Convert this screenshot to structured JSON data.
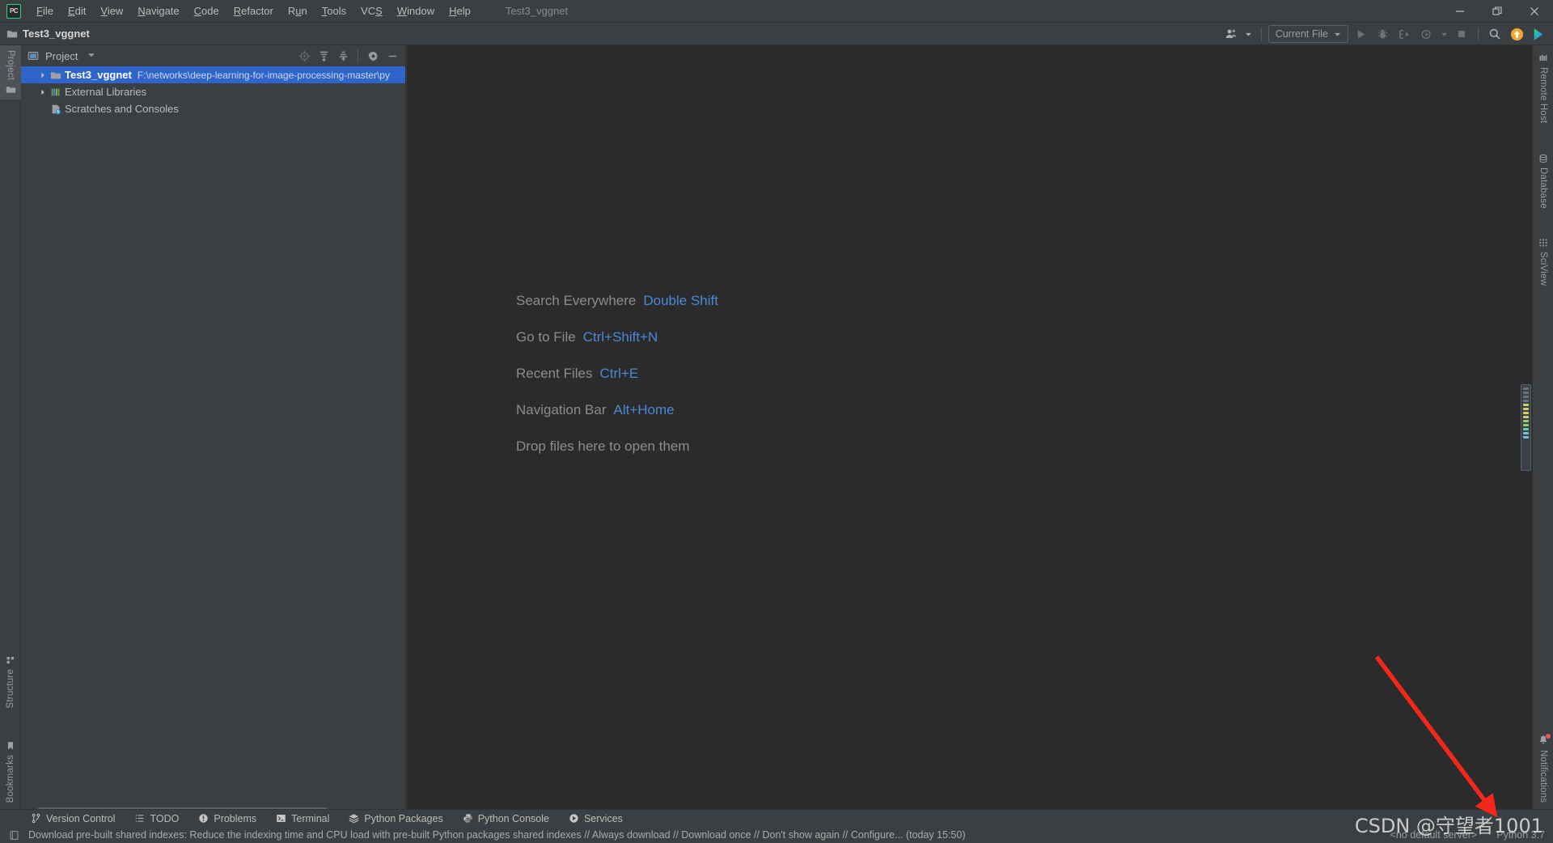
{
  "window": {
    "app_logo": "pycharm-logo",
    "project_title": "Test3_vggnet",
    "menu": [
      {
        "label": "File",
        "mnemonic": "F"
      },
      {
        "label": "Edit",
        "mnemonic": "E"
      },
      {
        "label": "View",
        "mnemonic": "V"
      },
      {
        "label": "Navigate",
        "mnemonic": "N"
      },
      {
        "label": "Code",
        "mnemonic": "C"
      },
      {
        "label": "Refactor",
        "mnemonic": "R"
      },
      {
        "label": "Run",
        "mnemonic": "u"
      },
      {
        "label": "Tools",
        "mnemonic": "T"
      },
      {
        "label": "VCS",
        "mnemonic": "S"
      },
      {
        "label": "Window",
        "mnemonic": "W"
      },
      {
        "label": "Help",
        "mnemonic": "H"
      }
    ],
    "controls": {
      "minimize": "minimize-icon",
      "restore": "restore-icon",
      "close": "close-icon"
    }
  },
  "toolbar": {
    "project_name": "Test3_vggnet",
    "run_config": "Current File",
    "icons": {
      "user": "user-icon",
      "run": "run-icon",
      "debug": "debug-icon",
      "run_coverage": "run-with-coverage-icon",
      "profile": "profile-icon",
      "stop": "stop-icon",
      "search": "search-icon",
      "updates": "update-available-icon",
      "ide_logo": "ide-logo-icon"
    }
  },
  "left_strip": {
    "top": [
      {
        "label": "Project",
        "icon": "project-icon",
        "active": true
      }
    ],
    "bottom": [
      {
        "label": "Structure",
        "icon": "structure-icon"
      },
      {
        "label": "Bookmarks",
        "icon": "bookmark-icon"
      }
    ]
  },
  "right_strip": {
    "top": [
      {
        "label": "Remote Host",
        "icon": "remote-host-icon"
      },
      {
        "label": "Database",
        "icon": "database-icon"
      },
      {
        "label": "SciView",
        "icon": "sciview-icon"
      }
    ],
    "bottom": [
      {
        "label": "Notifications",
        "icon": "notifications-bell-icon",
        "badge": true
      }
    ]
  },
  "project_panel": {
    "title": "Project",
    "dropdown": "chevron-down-icon",
    "header_icons": [
      {
        "name": "select-opened-file-icon",
        "dim": true
      },
      {
        "name": "expand-all-icon",
        "dim": false
      },
      {
        "name": "collapse-all-icon",
        "dim": false
      },
      {
        "name": "settings-gear-icon",
        "dim": false
      },
      {
        "name": "hide-panel-icon",
        "dim": false
      }
    ],
    "tree": [
      {
        "label": "Test3_vggnet",
        "path": "F:\\networks\\deep-learning-for-image-processing-master\\py",
        "icon": "folder-icon",
        "expandable": true,
        "selected": true,
        "bold": true,
        "indent": 0
      },
      {
        "label": "External Libraries",
        "path": "",
        "icon": "external-libraries-icon",
        "expandable": true,
        "selected": false,
        "bold": false,
        "indent": 0
      },
      {
        "label": "Scratches and Consoles",
        "path": "",
        "icon": "scratches-icon",
        "expandable": false,
        "selected": false,
        "bold": false,
        "indent": 0
      }
    ]
  },
  "editor": {
    "welcome": [
      {
        "action": "Search Everywhere",
        "shortcut": "Double Shift"
      },
      {
        "action": "Go to File",
        "shortcut": "Ctrl+Shift+N"
      },
      {
        "action": "Recent Files",
        "shortcut": "Ctrl+E"
      },
      {
        "action": "Navigation Bar",
        "shortcut": "Alt+Home"
      },
      {
        "action": "Drop files here to open them",
        "shortcut": ""
      }
    ]
  },
  "bottom_bar": [
    {
      "label": "Version Control",
      "icon": "branch-icon"
    },
    {
      "label": "TODO",
      "icon": "todo-list-icon"
    },
    {
      "label": "Problems",
      "icon": "problems-icon"
    },
    {
      "label": "Terminal",
      "icon": "terminal-icon"
    },
    {
      "label": "Python Packages",
      "icon": "packages-icon"
    },
    {
      "label": "Python Console",
      "icon": "python-console-icon"
    },
    {
      "label": "Services",
      "icon": "services-icon"
    }
  ],
  "status_bar": {
    "icon": "event-log-icon",
    "message": "Download pre-built shared indexes: Reduce the indexing time and CPU load with pre-built Python packages shared indexes // Always download // Download once // Don't show again // Configure... (today 15:50)",
    "server": "<no default server>",
    "interpreter": "Python 3.7"
  },
  "annotation": {
    "watermark": "CSDN @守望者1001",
    "arrow": "red-arrow-annotation"
  },
  "colors": {
    "accent_blue": "#4a88d8",
    "selection_blue": "#2f65ca",
    "panel_bg": "#3c3f41",
    "editor_bg": "#2b2b2b",
    "text": "#bbbbbb",
    "arrow_red": "#f4271b",
    "logo_green": "#21d789",
    "badge_red": "#e4584f"
  }
}
